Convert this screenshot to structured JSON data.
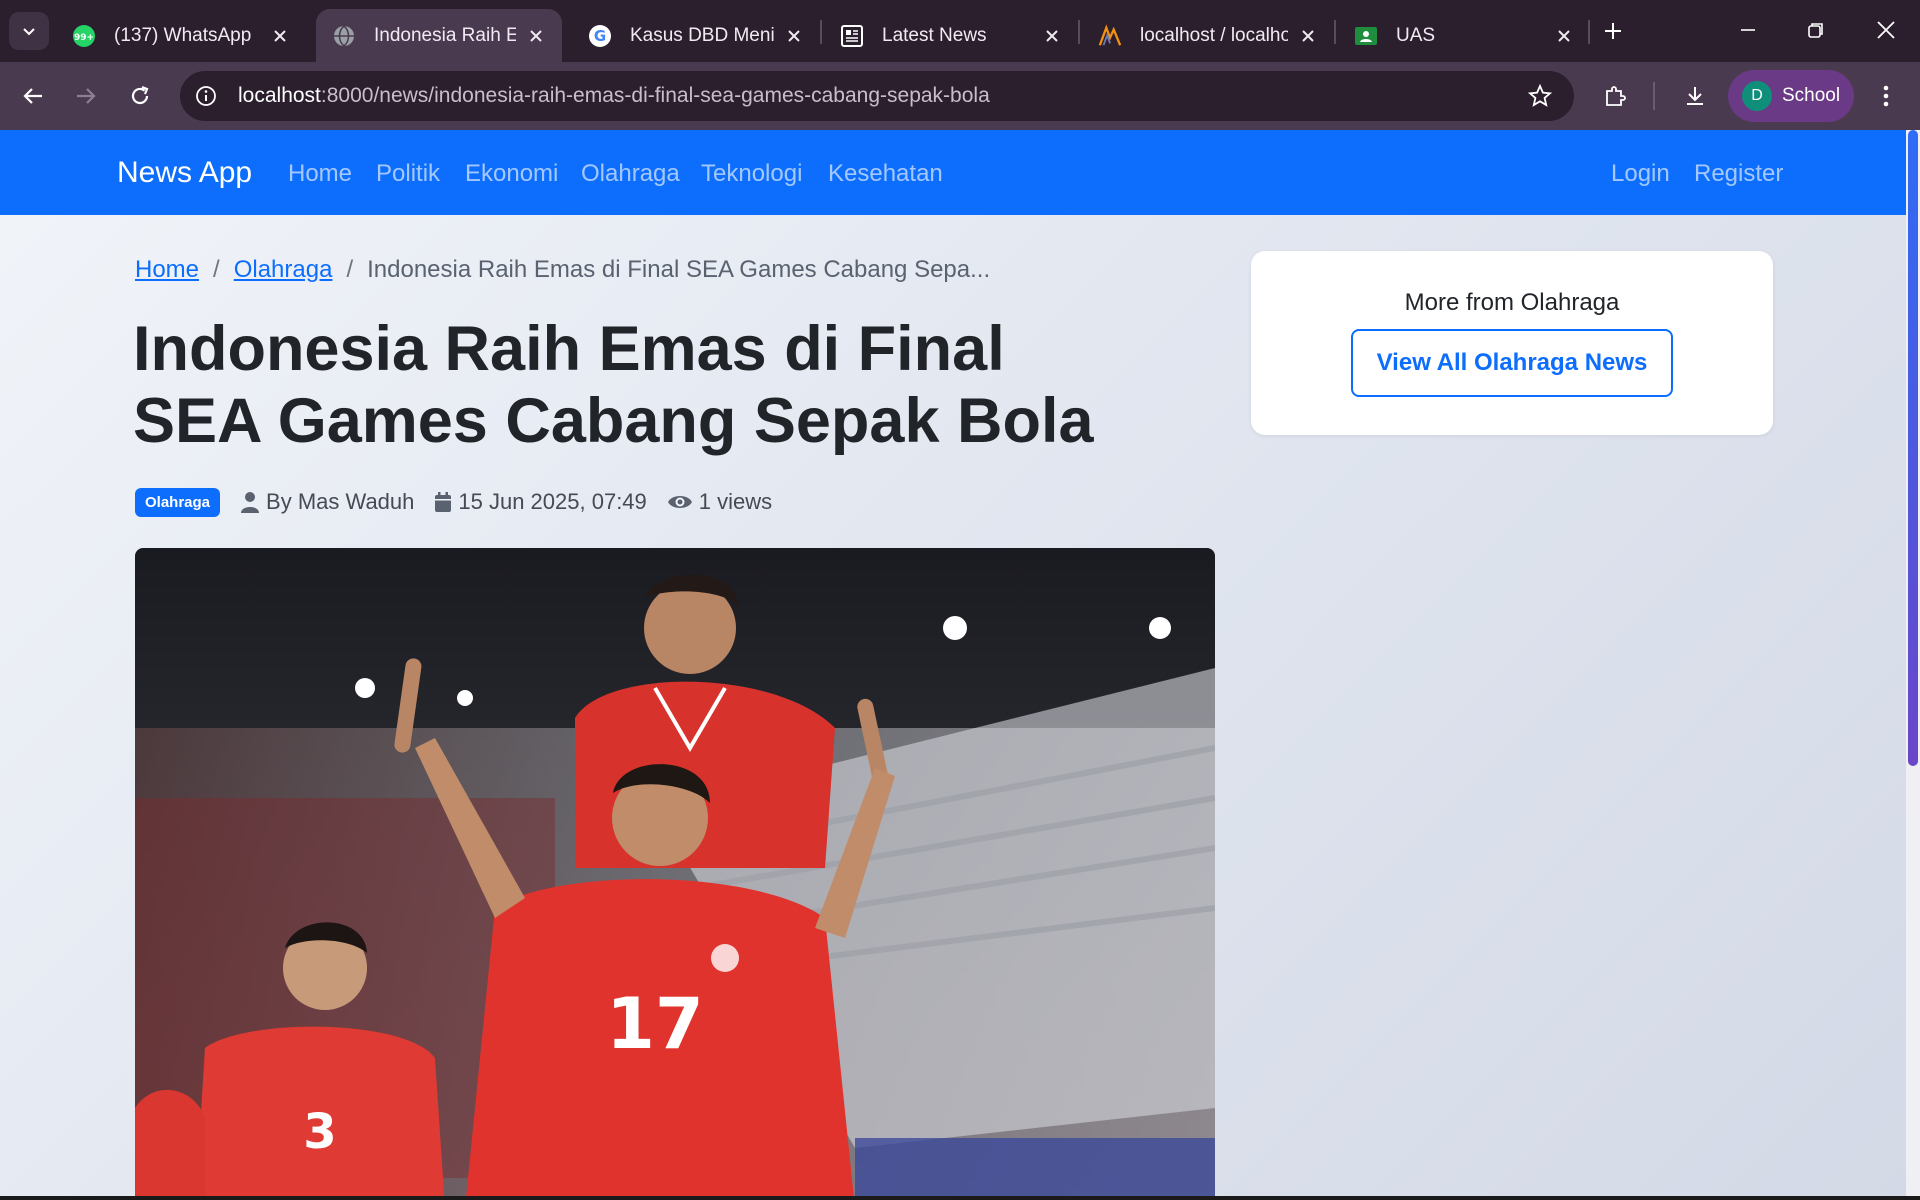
{
  "browser": {
    "tabs": [
      {
        "title": "(137) WhatsApp",
        "icon": "whatsapp-icon",
        "badge": "99+"
      },
      {
        "title": "Indonesia Raih Emas di Final SEA Games Cabang Sepak Bola",
        "icon": "globe-icon"
      },
      {
        "title": "Kasus DBD Meningkat",
        "icon": "google-icon"
      },
      {
        "title": "Latest News",
        "icon": "news-icon"
      },
      {
        "title": "localhost / localhost",
        "icon": "phpmyadmin-icon"
      },
      {
        "title": "UAS",
        "icon": "classroom-icon"
      }
    ],
    "url_host": "localhost",
    "url_path": ":8000/news/indonesia-raih-emas-di-final-sea-games-cabang-sepak-bola",
    "profile_initial": "D",
    "profile_name": "School"
  },
  "navbar": {
    "brand": "News App",
    "links": [
      "Home",
      "Politik",
      "Ekonomi",
      "Olahraga",
      "Teknologi",
      "Kesehatan"
    ],
    "auth": [
      "Login",
      "Register"
    ]
  },
  "breadcrumb": {
    "home": "Home",
    "category": "Olahraga",
    "current": "Indonesia Raih Emas di Final SEA Games Cabang Sepa..."
  },
  "article": {
    "title": "Indonesia Raih Emas di Final SEA Games Cabang Sepak Bola",
    "category_badge": "Olahraga",
    "author": "By Mas Waduh",
    "date": "15 Jun 2025, 07:49",
    "views": "1 views"
  },
  "sidebar": {
    "heading": "More from Olahraga",
    "button": "View All Olahraga News"
  },
  "colors": {
    "primary": "#0d6efd",
    "chrome_dark": "#2b1f2e",
    "chrome_toolbar": "#4a3a4f",
    "profile": "#6a3a86"
  }
}
